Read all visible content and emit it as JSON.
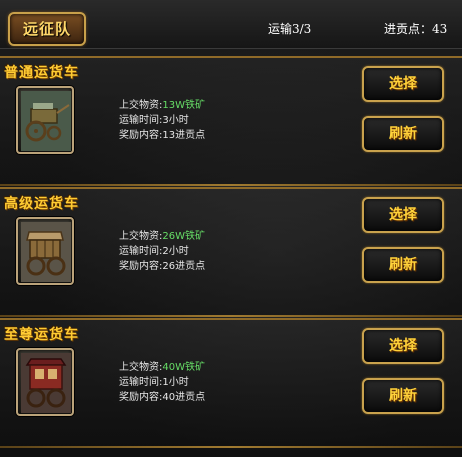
{
  "header": {
    "title": "远征队",
    "transport_label": "运输3/3",
    "points_label": "进贡点：43"
  },
  "carts": [
    {
      "name": "普通运货车",
      "material_label": "上交物资:",
      "material_value": "13W铁矿",
      "time_text": "运输时间:3小时",
      "reward_text": "奖励内容:13进贡点",
      "select_label": "选择",
      "refresh_label": "刷新"
    },
    {
      "name": "高级运货车",
      "material_label": "上交物资:",
      "material_value": "26W铁矿",
      "time_text": "运输时间:2小时",
      "reward_text": "奖励内容:26进贡点",
      "select_label": "选择",
      "refresh_label": "刷新"
    },
    {
      "name": "至尊运货车",
      "material_label": "上交物资:",
      "material_value": "40W铁矿",
      "time_text": "运输时间:1小时",
      "reward_text": "奖励内容:40进贡点",
      "select_label": "选择",
      "refresh_label": "刷新"
    }
  ],
  "colors": {
    "title_gold": "#ffcc33",
    "material_green": "#66dd66",
    "border_gold": "#c9a24d"
  },
  "icons": [
    "handcart-icon",
    "wagon-icon",
    "carriage-icon"
  ]
}
